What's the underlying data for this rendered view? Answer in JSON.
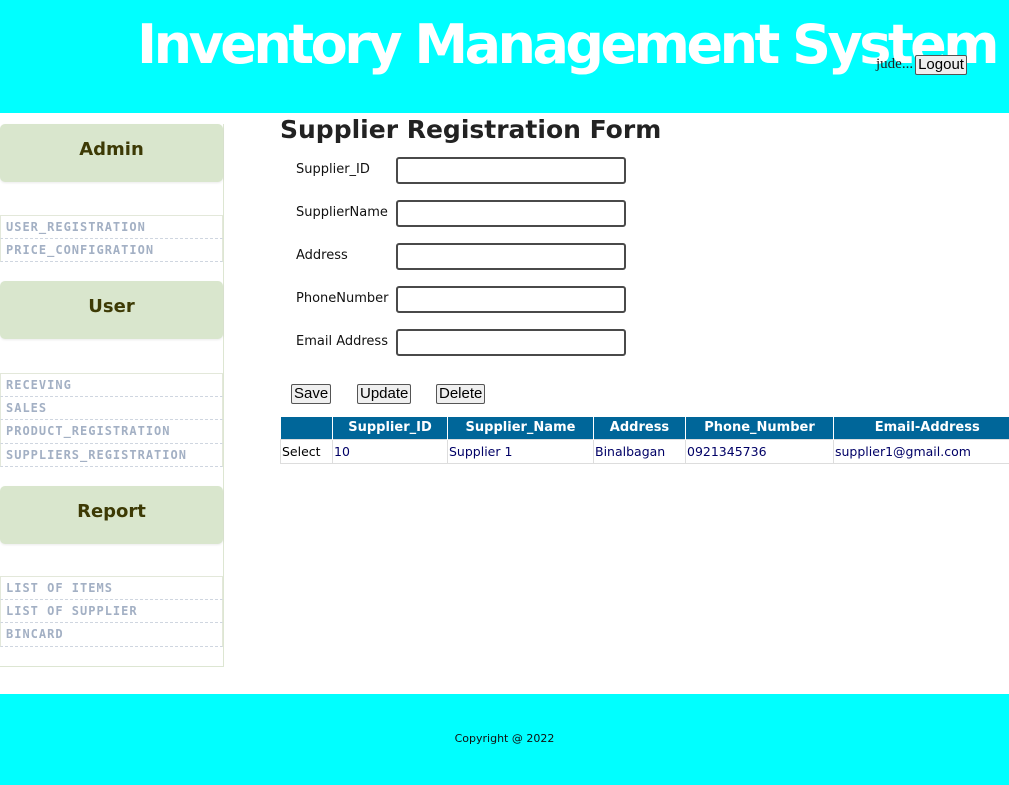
{
  "header": {
    "title": "Inventory Management System",
    "username": "jude...",
    "logout_label": "Logout"
  },
  "sidebar": {
    "sections": [
      {
        "title": "Admin",
        "items": [
          "USER_REGISTRATION",
          "PRICE_CONFIGRATION"
        ]
      },
      {
        "title": "User",
        "items": [
          "RECEVING",
          "SALES",
          "PRODUCT_REGISTRATION",
          "SUPPLIERS_REGISTRATION"
        ]
      },
      {
        "title": "Report",
        "items": [
          "LIST OF ITEMS",
          "LIST OF SUPPLIER",
          "BINCARD"
        ]
      }
    ]
  },
  "form": {
    "title": "Supplier Registration Form",
    "fields": {
      "supplier_id": {
        "label": "Supplier_ID",
        "value": ""
      },
      "supplier_name": {
        "label": "SupplierName",
        "value": ""
      },
      "address": {
        "label": "Address",
        "value": ""
      },
      "phone": {
        "label": "PhoneNumber",
        "value": ""
      },
      "email": {
        "label": "Email Address",
        "value": ""
      }
    },
    "buttons": {
      "save": "Save",
      "update": "Update",
      "delete": "Delete"
    }
  },
  "table": {
    "columns": [
      "",
      "Supplier_ID",
      "Supplier_Name",
      "Address",
      "Phone_Number",
      "Email-Address"
    ],
    "rows": [
      {
        "select": "Select",
        "id": "10",
        "name": "Supplier 1",
        "address": "Binalbagan",
        "phone": "0921345736",
        "email": "supplier1@gmail.com"
      }
    ]
  },
  "footer": {
    "copyright": "Copyright @ 2022"
  },
  "colors": {
    "header_bg": "#00ffff",
    "table_header": "#006699",
    "menu_header": "#d9e6cd"
  }
}
